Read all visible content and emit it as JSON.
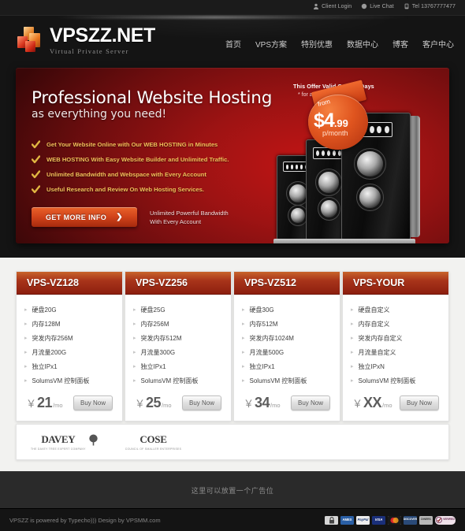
{
  "topbar": {
    "links": [
      {
        "label": "Client Login",
        "icon": "user-icon"
      },
      {
        "label": "Live Chat",
        "icon": "chat-bubble-icon"
      },
      {
        "label": "Tel 13767777477",
        "icon": "phone-icon"
      }
    ]
  },
  "logo": {
    "title": "VPSZZ.NET",
    "subtitle": "Virtual Private Server",
    "icon": "cubes-logo-icon"
  },
  "nav": {
    "items": [
      {
        "label": "首页"
      },
      {
        "label": "VPS方案"
      },
      {
        "label": "特别优惠"
      },
      {
        "label": "数据中心"
      },
      {
        "label": "博客"
      },
      {
        "label": "客户中心"
      }
    ]
  },
  "hero": {
    "heading": "Professional Website Hosting",
    "subheading": "as everything you need!",
    "bullets": [
      "Get Your Website Online with Our WEB HOSTING in Minutes",
      "WEB HOSTING With Easy Website Builder and Unlimited Traffic.",
      "Unlimited Bandwidth and Webspace with Every Account",
      "Useful Research and Review On Web Hosting Services."
    ],
    "cta_label": "GET MORE INFO",
    "cta_arrow": "❯",
    "cta_note_line1": "Unlimited Powerful Bandwidth",
    "cta_note_line2": "With Every Account",
    "offer_line1": "This Offer Valid Only 30 Days",
    "offer_line2": "* for any package",
    "badge": {
      "from": "from",
      "currency_amount": "$4",
      "cents": ".99",
      "per": "p/month"
    },
    "accent_color": "#a8341a",
    "bullet_color": "#f0c05a"
  },
  "cards": [
    {
      "title": "VPS-VZ128",
      "features": [
        "硬盘20G",
        "内存128M",
        "突发内存256M",
        "月流量200G",
        "独立IPx1",
        "SolumsVM 控制面板"
      ],
      "currency": "￥",
      "price": "21",
      "period": "/mo",
      "buy_label": "Buy Now"
    },
    {
      "title": "VPS-VZ256",
      "features": [
        "硬盘25G",
        "内存256M",
        "突发内存512M",
        "月流量300G",
        "独立IPx1",
        "SolumsVM 控制面板"
      ],
      "currency": "￥",
      "price": "25",
      "period": "/mo",
      "buy_label": "Buy Now"
    },
    {
      "title": "VPS-VZ512",
      "features": [
        "硬盘30G",
        "内存512M",
        "突发内存1024M",
        "月流量500G",
        "独立IPx1",
        "SolumsVM 控制面板"
      ],
      "currency": "￥",
      "price": "34",
      "period": "/mo",
      "buy_label": "Buy Now"
    },
    {
      "title": "VPS-YOUR",
      "features": [
        "硬盘自定义",
        "内存自定义",
        "突发内存自定义",
        "月流量自定义",
        "独立IPxN",
        "SolumsVM 控制面板"
      ],
      "currency": "￥",
      "price": "XX",
      "period": "/mo",
      "buy_label": "Buy Now"
    }
  ],
  "partners": [
    {
      "name": "DAVEY",
      "sub": "THE DAVEY TREE EXPERT COMPANY",
      "icon": "tree-icon"
    },
    {
      "name": "COSE",
      "sub": "COUNCIL OF SMALLER ENTERPRISES",
      "icon": "cose-logo-icon"
    }
  ],
  "ad": {
    "text": "这里可以放置一个广告位"
  },
  "footer": {
    "text": "VPSZZ is powered by Typecho))) Design by VPSMM.com",
    "payments": [
      {
        "label": "",
        "name": "lock-icon",
        "bg": "#d6d6d6",
        "fg": "#333"
      },
      {
        "label": "AMEX",
        "name": "amex-card-icon",
        "bg": "#2a5fa5",
        "fg": "#ffffff"
      },
      {
        "label": "PayPal",
        "name": "paypal-icon",
        "bg": "#eeeeee",
        "fg": "#1f3d78"
      },
      {
        "label": "VISA",
        "name": "visa-card-icon",
        "bg": "#1a2f7a",
        "fg": "#ffffff"
      },
      {
        "label": "",
        "name": "mastercard-icon",
        "bg": "#d8a320",
        "fg": "#ffffff"
      },
      {
        "label": "DISCOVER",
        "name": "discover-card-icon",
        "bg": "#2a4a78",
        "fg": "#ffffff"
      },
      {
        "label": "DINERS",
        "name": "diners-card-icon",
        "bg": "#b8b8b8",
        "fg": "#333333"
      },
      {
        "label": "VERIFIED",
        "name": "verified-badge-icon",
        "bg": "#e8d6e2",
        "fg": "#6a2a52"
      }
    ]
  }
}
